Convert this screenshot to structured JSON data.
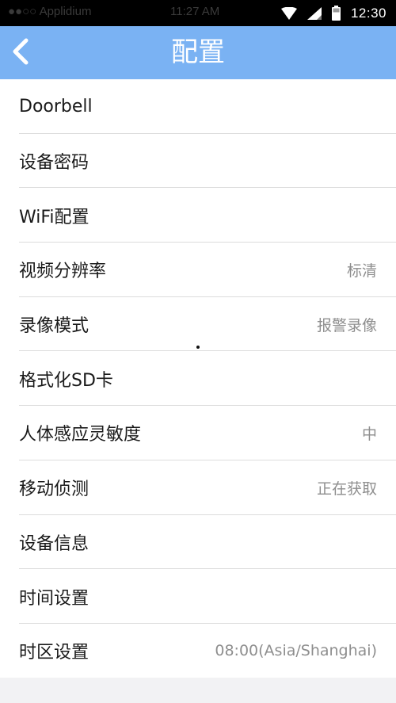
{
  "status_bar": {
    "ghost_left": "●●○○ Applidium",
    "ghost_time": "11:27 AM",
    "time": "12:30",
    "icons": [
      "wifi-icon",
      "signal-icon",
      "battery-icon"
    ]
  },
  "header": {
    "title": "配置",
    "back_icon": "chevron-left-icon",
    "background_color": "#7ab2f3"
  },
  "settings": {
    "items": [
      {
        "label": "Doorbell",
        "value": ""
      },
      {
        "label": "设备密码",
        "value": ""
      },
      {
        "label": "WiFi配置",
        "value": ""
      },
      {
        "label": "视频分辨率",
        "value": "标清"
      },
      {
        "label": "录像模式",
        "value": "报警录像"
      },
      {
        "label": "格式化SD卡",
        "value": ""
      },
      {
        "label": "人体感应灵敏度",
        "value": "中"
      },
      {
        "label": "移动侦测",
        "value": "正在获取"
      },
      {
        "label": "设备信息",
        "value": ""
      },
      {
        "label": "时间设置",
        "value": ""
      },
      {
        "label": "时区设置",
        "value": "08:00(Asia/Shanghai)"
      }
    ]
  }
}
